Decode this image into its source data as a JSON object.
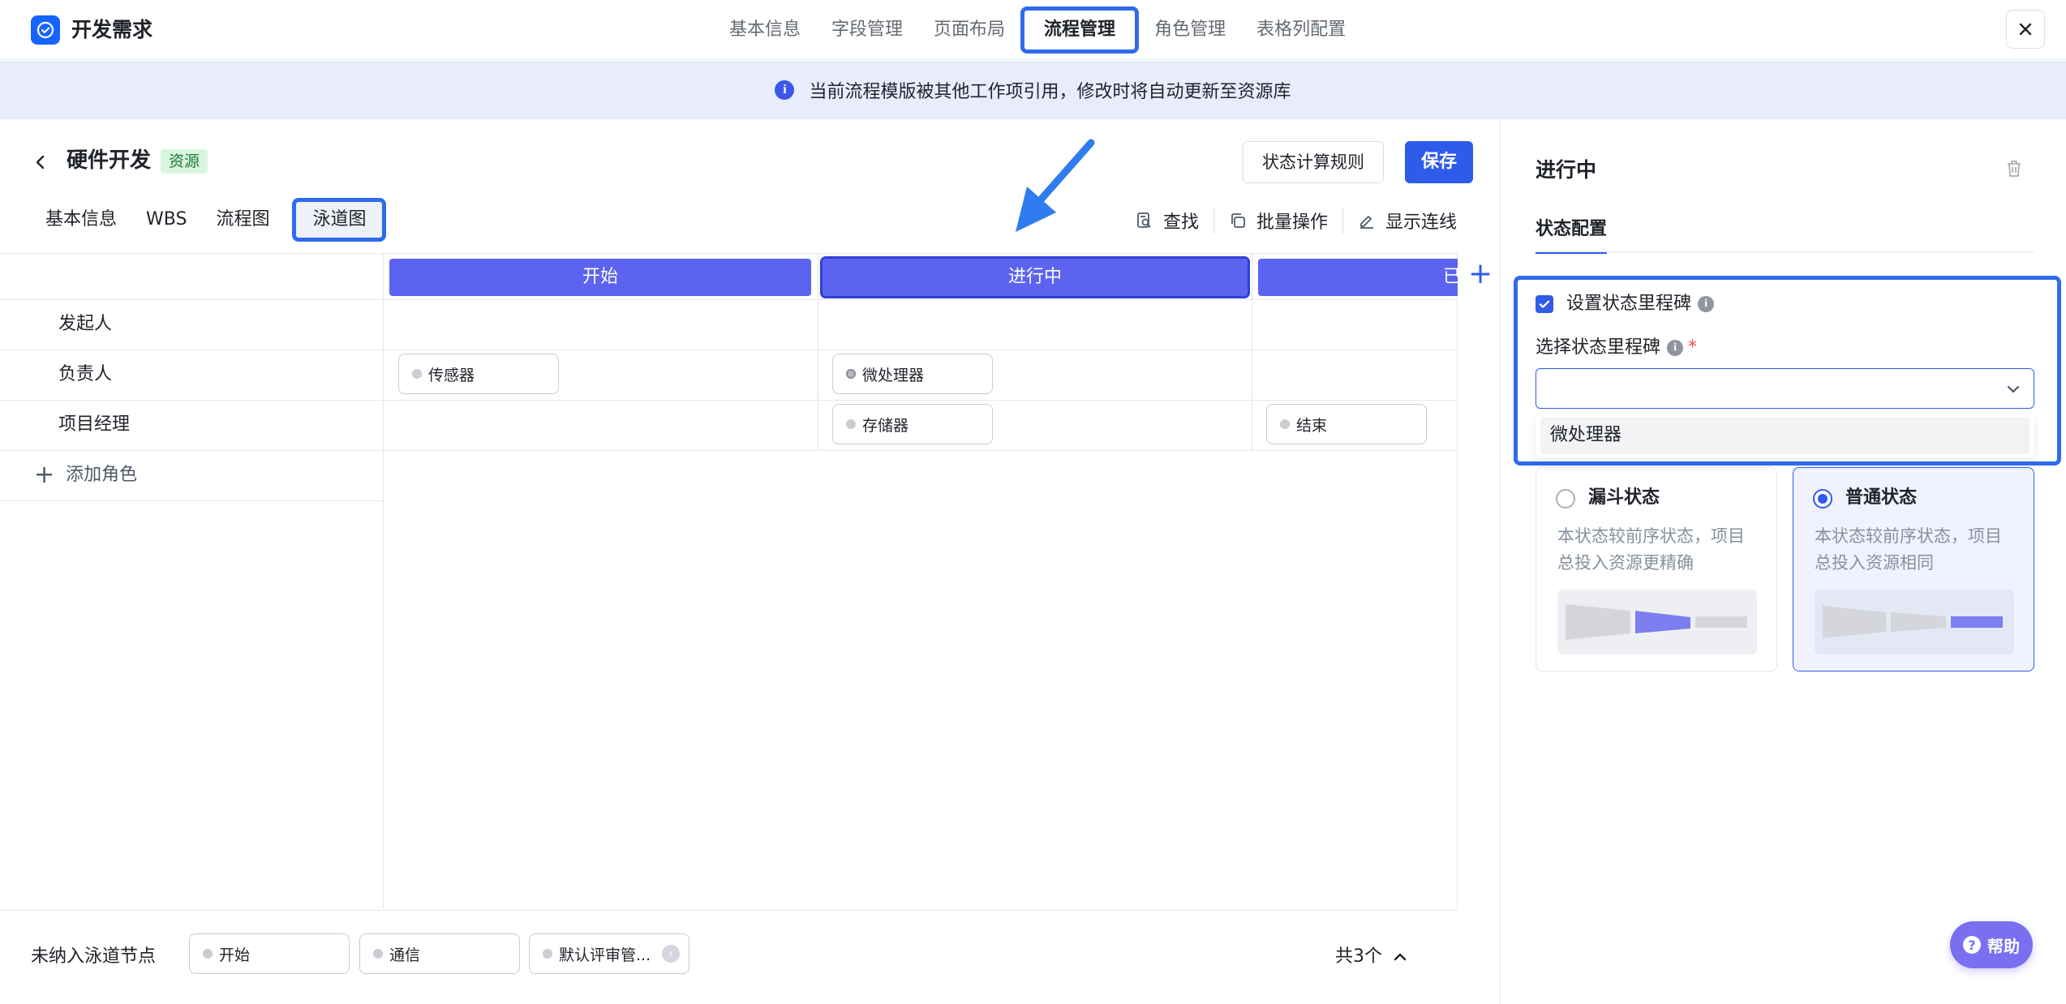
{
  "app": {
    "title": "开发需求"
  },
  "top_tabs": [
    {
      "label": "基本信息"
    },
    {
      "label": "字段管理"
    },
    {
      "label": "页面布局"
    },
    {
      "label": "流程管理"
    },
    {
      "label": "角色管理"
    },
    {
      "label": "表格列配置"
    }
  ],
  "active_top_tab": "流程管理",
  "notice": {
    "text": "当前流程模版被其他工作项引用，修改时将自动更新至资源库",
    "icon": "info-icon"
  },
  "project": {
    "title": "硬件开发",
    "tag": "资源"
  },
  "actions": {
    "rule_label": "状态计算规则",
    "save_label": "保存"
  },
  "sub_tabs": [
    {
      "label": "基本信息"
    },
    {
      "label": "WBS"
    },
    {
      "label": "流程图"
    },
    {
      "label": "泳道图"
    }
  ],
  "tools": [
    {
      "label": "查找",
      "icon": "search-doc-icon"
    },
    {
      "label": "批量操作",
      "icon": "copy-icon"
    },
    {
      "label": "显示连线",
      "icon": "pen-icon"
    }
  ],
  "lanes": [
    {
      "label": "开始"
    },
    {
      "label": "进行中"
    },
    {
      "label": "已"
    }
  ],
  "roles": [
    {
      "label": "发起人"
    },
    {
      "label": "负责人"
    },
    {
      "label": "项目经理"
    }
  ],
  "add_role_label": "添加角色",
  "nodes": {
    "start_owner": "传感器",
    "progress_owner": "微处理器",
    "progress_pm": "存储器",
    "done_pm": "结束"
  },
  "bottom": {
    "label": "未纳入泳道节点",
    "nodes": [
      "开始",
      "通信",
      "默认评审管..."
    ],
    "count": "共3个"
  },
  "right_panel": {
    "title": "进行中",
    "tab": "状态配置",
    "milestone_checkbox_label": "设置状态里程碑",
    "select_label": "选择状态里程碑",
    "required_mark": "*",
    "dropdown_option": "微处理器",
    "types": [
      {
        "title": "漏斗状态",
        "desc": "本状态较前序状态，项目总投入资源更精确",
        "selected": false
      },
      {
        "title": "普通状态",
        "desc": "本状态较前序状态，项目总投入资源相同",
        "selected": true
      }
    ]
  },
  "help": {
    "label": "帮助"
  },
  "colors": {
    "accent": "#2f5bea",
    "lane": "#5b63ef",
    "highlight": "#2f6bec",
    "banner": "#e9ecfd"
  }
}
